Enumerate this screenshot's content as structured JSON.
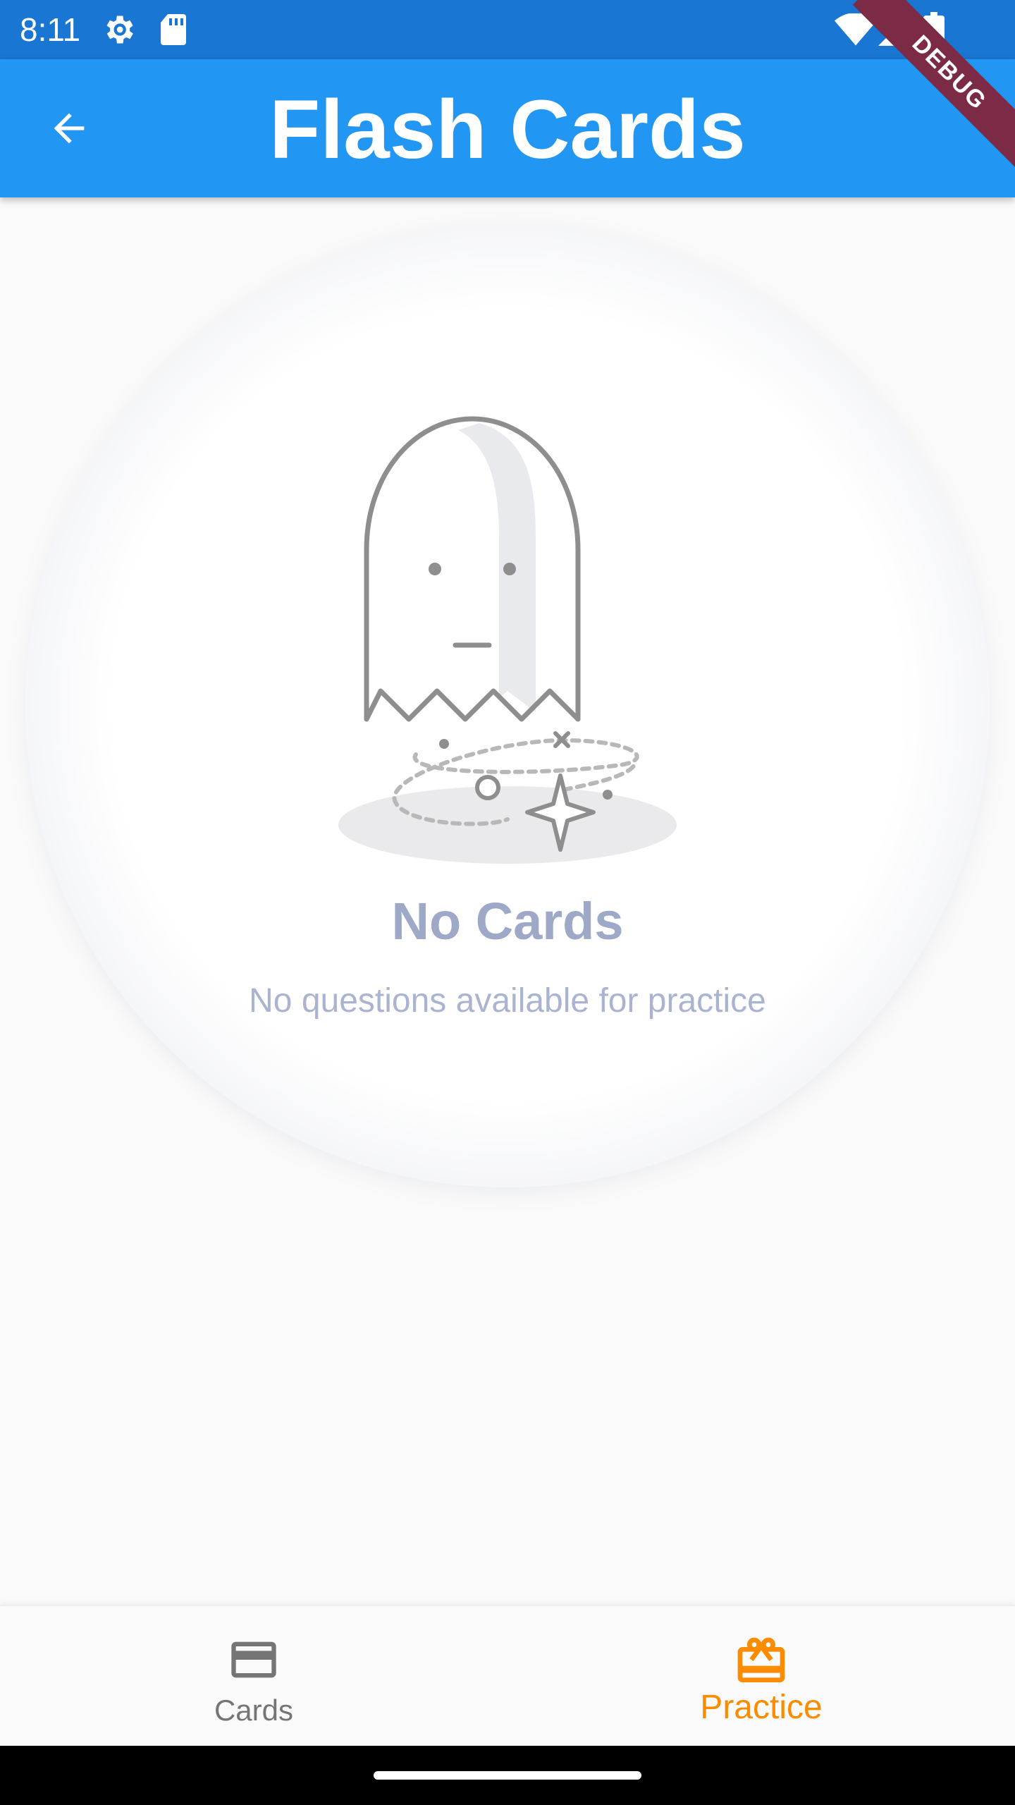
{
  "status_bar": {
    "time": "8:11",
    "icons": [
      "settings-gear-icon",
      "sd-card-icon",
      "wifi-icon",
      "signal-icon",
      "battery-icon"
    ]
  },
  "debug_ribbon": "DEBUG",
  "app_bar": {
    "title": "Flash Cards",
    "back_icon": "arrow-back-icon",
    "color": "#2196f3"
  },
  "empty_state": {
    "illustration": "ghost-icon",
    "title": "No Cards",
    "subtitle": "No questions available for practice"
  },
  "bottom_nav": {
    "items": [
      {
        "label": "Cards",
        "icon": "credit-card-icon",
        "selected": false
      },
      {
        "label": "Practice",
        "icon": "gift-card-icon",
        "selected": true
      }
    ],
    "selected_color": "#fb8c00",
    "unselected_color": "#757575"
  }
}
